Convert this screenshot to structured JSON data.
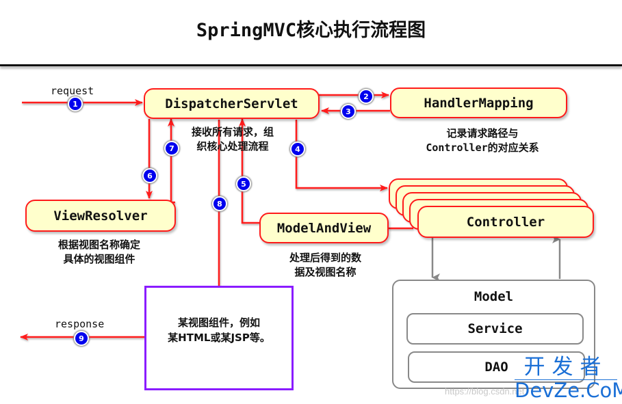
{
  "title": "SpringMVC核心执行流程图",
  "colors": {
    "arrow": "#ff1a1a",
    "node_fill": "#ffffcc",
    "node_border": "#ff1a1a",
    "badge": "#0000ee",
    "view_border": "#8a1cff",
    "model_border": "#888888",
    "brand": "#1a6fd6"
  },
  "nodes": {
    "dispatcher": "DispatcherServlet",
    "handler_mapping": "HandlerMapping",
    "view_resolver": "ViewResolver",
    "model_and_view": "ModelAndView",
    "controller": "Controller"
  },
  "notes": {
    "dispatcher": [
      "接收所有请求，组",
      "织核心处理流程"
    ],
    "handler_mapping": [
      "记录请求路径与",
      "Controller的对应关系"
    ],
    "view_resolver": [
      "根据视图名称确定",
      "具体的视图组件"
    ],
    "model_and_view": [
      "处理后得到的数",
      "据及视图名称"
    ],
    "view_component": [
      "某视图组件，例如",
      "某HTML或某JSP等。"
    ]
  },
  "labels": {
    "request": "request",
    "response": "response"
  },
  "steps": [
    "1",
    "2",
    "3",
    "4",
    "5",
    "6",
    "7",
    "8",
    "9"
  ],
  "model": {
    "title": "Model",
    "layers": [
      "Service",
      "DAO"
    ]
  },
  "watermark": "https://blog.csdn.net",
  "brand": {
    "cn": "开发者",
    "en": "DevZe.CoM"
  }
}
